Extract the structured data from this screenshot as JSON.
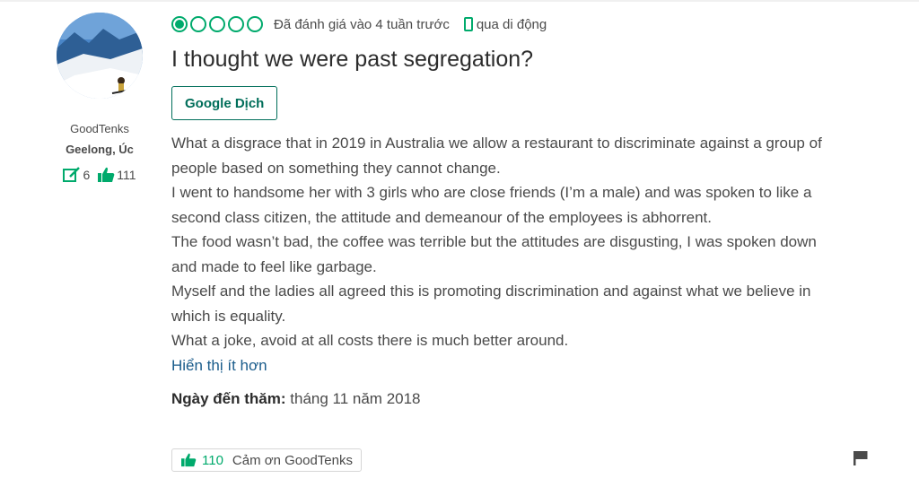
{
  "reviewer": {
    "name": "GoodTenks",
    "location": "Geelong, Úc",
    "reviews_count": "6",
    "helpful_count": "111"
  },
  "review": {
    "rating": 1,
    "rating_max": 5,
    "date_text": "Đã đánh giá vào 4 tuần trước",
    "device_text": "qua di động",
    "title": "I thought we were past segregation?",
    "translate_label": "Google Dịch",
    "paragraphs": [
      "What a disgrace that in 2019 in Australia we allow a restaurant to discriminate against a group of people based on something they cannot change.",
      "I went to handsome her with 3 girls who are close friends (I’m a male) and was spoken to like a second class citizen, the attitude and demeanour of the employees is abhorrent.",
      "The food wasn’t bad, the coffee was terrible but the attitudes are disgusting, I was spoken down and made to feel like garbage.",
      "Myself and the ladies all agreed this is promoting discrimination and against what we believe in which is equality.",
      "What a joke, avoid at all costs there is much better around."
    ],
    "show_less": "Hiển thị ít hơn",
    "visit_label": "Ngày đến thăm:",
    "visit_date": "tháng 11 năm 2018",
    "thanks_count": "110",
    "thanks_label": "Cảm ơn GoodTenks"
  },
  "colors": {
    "accent": "#00aa6c",
    "button_text": "#006e5a",
    "link": "#1a5c8b"
  },
  "icons": {
    "review_count": "edit-icon",
    "helpful": "thumbs-up-icon",
    "device": "mobile-icon",
    "report": "flag-icon"
  }
}
